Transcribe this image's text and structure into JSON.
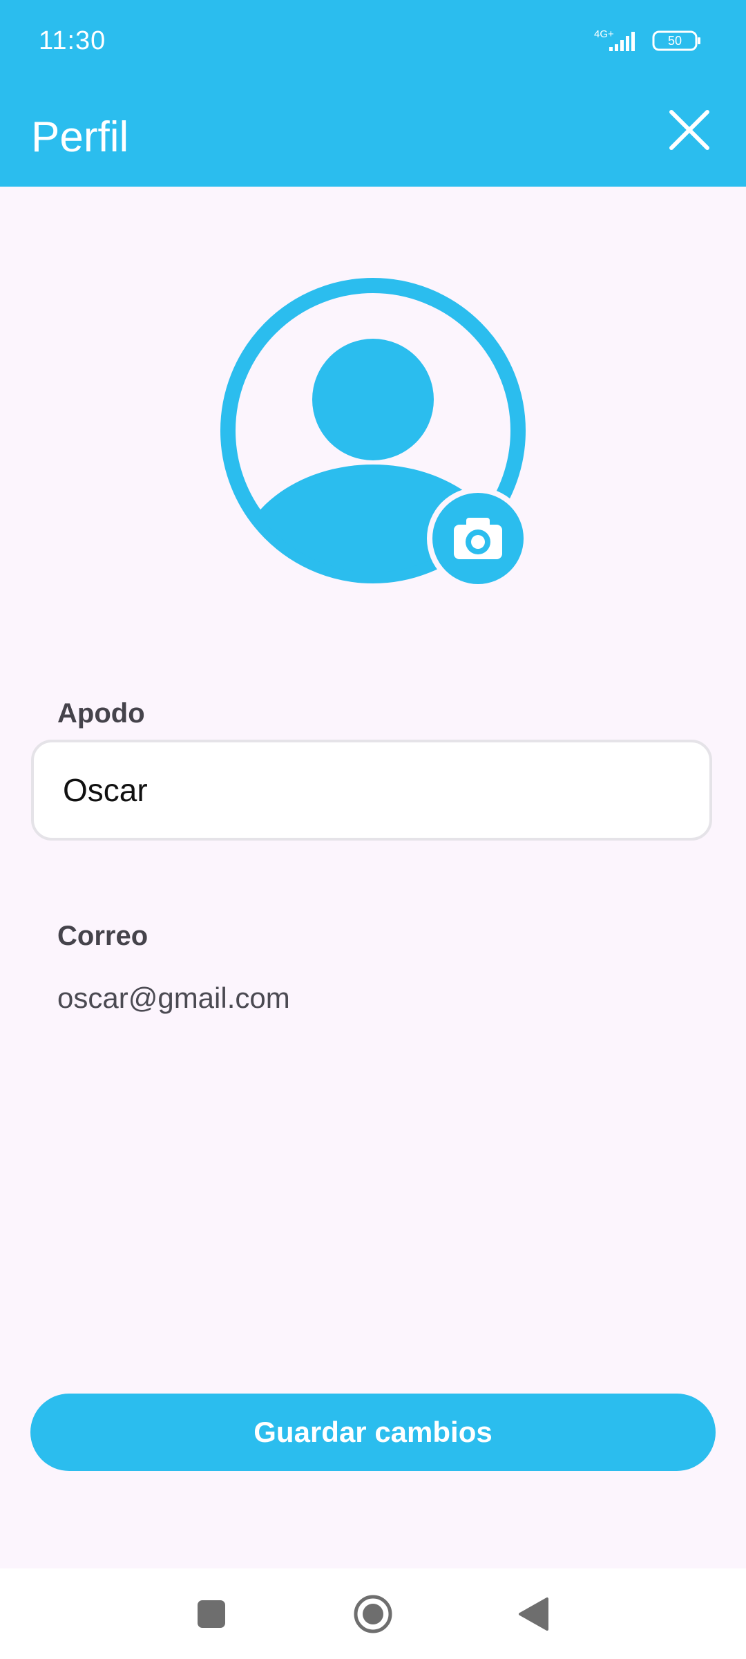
{
  "status_bar": {
    "time": "11:30",
    "network": "4G+",
    "battery": "50"
  },
  "app_bar": {
    "title": "Perfil",
    "close_icon": "close-icon"
  },
  "avatar": {
    "icon": "person-icon",
    "badge_icon": "camera-icon"
  },
  "form": {
    "nickname_label": "Apodo",
    "nickname_value": "Oscar",
    "email_label": "Correo",
    "email_value": "oscar@gmail.com"
  },
  "actions": {
    "save_label": "Guardar cambios"
  },
  "nav_bar": {
    "recents_icon": "square-icon",
    "home_icon": "home-circle-icon",
    "back_icon": "back-triangle-icon"
  },
  "colors": {
    "primary": "#2BBDEE",
    "background": "#FCF5FD",
    "label": "#45434B"
  }
}
